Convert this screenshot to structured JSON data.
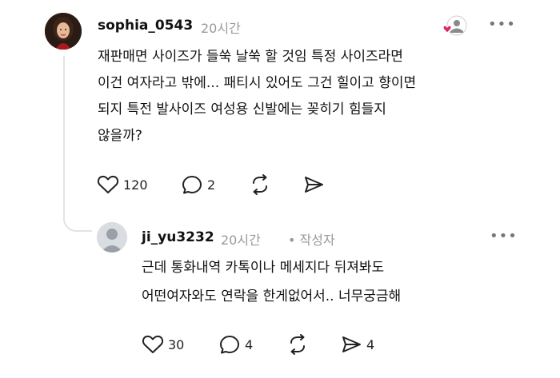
{
  "main_post": {
    "username": "sophia_0543",
    "time": "20시간",
    "body_lines": [
      "재판매면 사이즈가 들쑥 날쑥 할 것임 특정 사이즈라면",
      "이건 여자라고 밖에... 패티시 있어도 그건 힐이고 향이면",
      "되지 특전 발사이즈 여성용 신발에는 꽂히기 힘들지",
      "않을까?"
    ],
    "likes": "120",
    "comments": "2",
    "more": "•••",
    "like_badge_color": "#e0245e"
  },
  "reply": {
    "username": "ji_yu3232",
    "time": "20시간",
    "author_tag": "• 작성자",
    "body_lines": [
      "근데 통화내역 카톡이나 메세지다 뒤져봐도",
      "어떤여자와도 연락을 한게없어서.. 너무궁금해"
    ],
    "likes": "30",
    "comments": "4",
    "shares": "4",
    "more": "•••"
  },
  "icons": [
    "heart-icon",
    "comment-icon",
    "repost-icon",
    "share-icon",
    "more-icon",
    "avatar-icon"
  ]
}
